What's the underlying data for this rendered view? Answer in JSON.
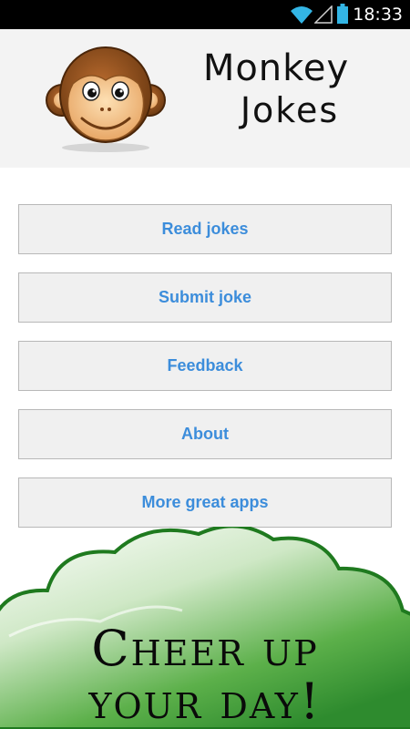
{
  "status_bar": {
    "time": "18:33",
    "icons": [
      "wifi-icon",
      "signal-icon",
      "battery-icon"
    ]
  },
  "header": {
    "logo_line1": "Monkey",
    "logo_line2": "Jokes"
  },
  "menu": {
    "items": [
      {
        "label": "Read jokes"
      },
      {
        "label": "Submit joke"
      },
      {
        "label": "Feedback"
      },
      {
        "label": "About"
      },
      {
        "label": "More great apps"
      }
    ]
  },
  "banner": {
    "line1": "Cheer up",
    "line2": "your day!"
  },
  "colors": {
    "accent_text": "#3c8ddb",
    "status_icon": "#33b5e5",
    "banner_green": "#2e8b2e"
  }
}
